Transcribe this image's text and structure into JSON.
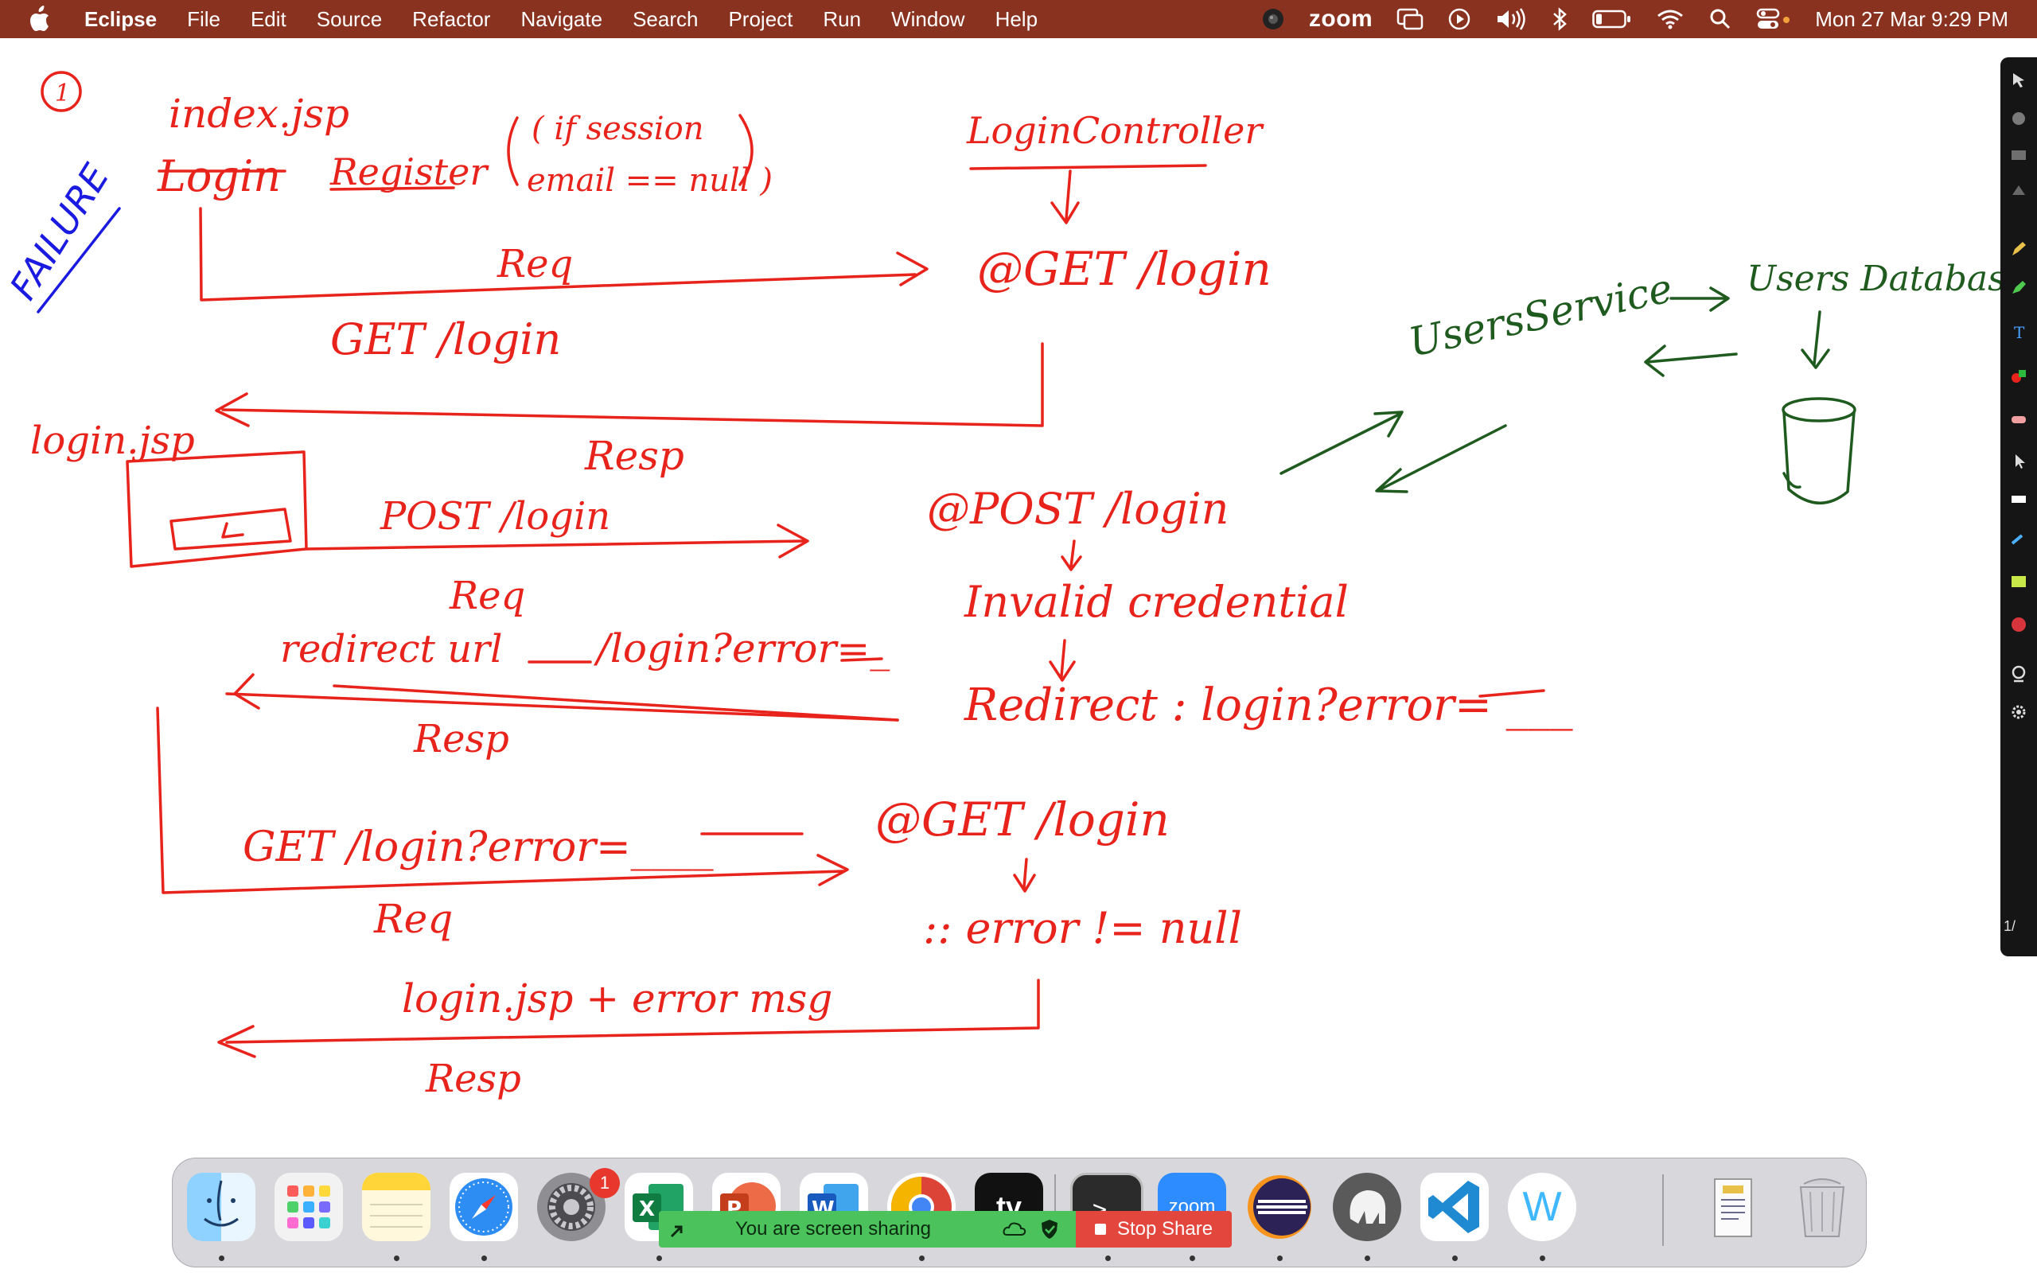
{
  "menubar": {
    "app_name": "Eclipse",
    "menus": [
      "File",
      "Edit",
      "Source",
      "Refactor",
      "Navigate",
      "Search",
      "Project",
      "Run",
      "Window",
      "Help"
    ],
    "zoom_label": "zoom",
    "clock": "Mon 27 Mar  9:29 PM",
    "status_icons": [
      "camera-icon",
      "screen-mirror-icon",
      "play-circle-icon",
      "volume-icon",
      "bluetooth-icon",
      "battery-icon",
      "wifi-icon",
      "search-icon",
      "control-center-icon"
    ]
  },
  "whiteboard": {
    "ink_color": "#e8231c",
    "ink_alt_color": "#1a1ae0",
    "ink_green_color": "#1f5a1f",
    "step_number": "1",
    "side_label": "FAILURE",
    "texts": {
      "index_jsp": "index.jsp",
      "login_link": "Login",
      "register_link": "Register",
      "session_note_1": "( if session",
      "session_note_2": "email == null )",
      "login_controller": "LoginController",
      "get_login_handler": "@GET /login",
      "req_1": "Req",
      "get_login_req": "GET  /login",
      "login_jsp": "login.jsp",
      "resp_1": "Resp",
      "form_box_letter": "L",
      "post_login_req": "POST  /login",
      "post_login_handler": "@POST /login",
      "req_2": "Req",
      "invalid_credential": "Invalid credential",
      "redirect_url": "redirect url",
      "redirect_target": "/login?error=_",
      "redirect_handler": "Redirect : login?error= ___",
      "resp_2": "Resp",
      "get_error_req": "GET  /login?error=____",
      "get_login_handler_2": "@GET /login",
      "req_3": "Req",
      "error_not_null": ":: error != null",
      "login_jsp_error": "login.jsp + error msg",
      "resp_3": "Resp",
      "users_service": "UsersService",
      "users_database": "Users Database"
    }
  },
  "annotation_toolbar": {
    "tools": [
      "pointer-icon",
      "spotlight-icon",
      "draw-icon",
      "stamp-icon",
      "pen-icon",
      "highlighter-icon",
      "text-icon",
      "shapes-icon",
      "eraser-icon",
      "arrow-icon",
      "line-icon",
      "color-icon",
      "camera-icon",
      "settings-icon"
    ],
    "page_label": "1/"
  },
  "dock": {
    "apps": [
      {
        "name": "Finder",
        "icon": "finder-icon"
      },
      {
        "name": "Launchpad",
        "icon": "launchpad-icon"
      },
      {
        "name": "Notes",
        "icon": "notes-icon"
      },
      {
        "name": "Safari",
        "icon": "safari-icon"
      },
      {
        "name": "System Settings",
        "icon": "settings-icon",
        "badge": "1"
      },
      {
        "name": "Excel",
        "icon": "excel-icon"
      },
      {
        "name": "PowerPoint",
        "icon": "powerpoint-icon"
      },
      {
        "name": "Word",
        "icon": "word-icon"
      },
      {
        "name": "Chrome",
        "icon": "chrome-icon"
      },
      {
        "name": "Apple TV",
        "icon": "appletv-icon",
        "label": "tv"
      },
      {
        "name": "Terminal",
        "icon": "terminal-icon",
        "label": ">_"
      },
      {
        "name": "Zoom",
        "icon": "zoom-icon",
        "label": "zoom"
      },
      {
        "name": "Eclipse",
        "icon": "eclipse-icon"
      },
      {
        "name": "Sequel Ace",
        "icon": "elephant-icon"
      },
      {
        "name": "VS Code",
        "icon": "vscode-icon"
      },
      {
        "name": "Webex",
        "icon": "webex-icon",
        "label": "W"
      },
      {
        "name": "Preview",
        "icon": "document-icon"
      },
      {
        "name": "Trash",
        "icon": "trash-icon"
      }
    ]
  },
  "screen_share": {
    "status_text": "You are screen sharing",
    "stop_label": "Stop Share"
  }
}
